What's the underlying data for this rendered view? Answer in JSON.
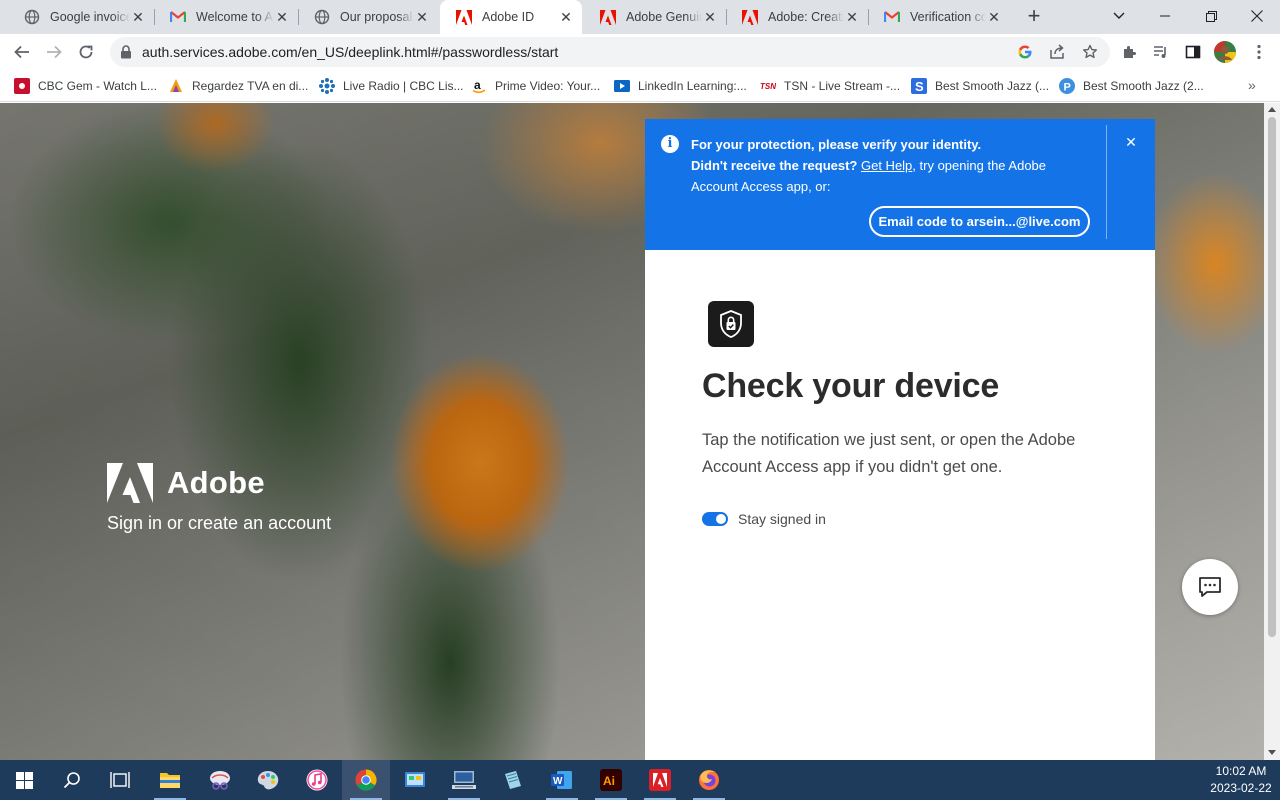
{
  "tabs": [
    {
      "title": "Google invoice",
      "favicon": "globe-icon"
    },
    {
      "title": "Welcome to Adobe",
      "favicon": "gmail-icon"
    },
    {
      "title": "Our proposal is",
      "favicon": "globe-icon"
    },
    {
      "title": "Adobe ID",
      "favicon": "adobe-icon",
      "active": true
    },
    {
      "title": "Adobe Genuine",
      "favicon": "adobe-icon"
    },
    {
      "title": "Adobe: Creative",
      "favicon": "adobe-icon"
    },
    {
      "title": "Verification code",
      "favicon": "gmail-icon"
    }
  ],
  "toolbar": {
    "url": "auth.services.adobe.com/en_US/deeplink.html#/passwordless/start"
  },
  "bookmarks": [
    {
      "label": "CBC Gem - Watch L...",
      "icon": "cbc-icon"
    },
    {
      "label": "Regardez TVA en di...",
      "icon": "tva-icon"
    },
    {
      "label": "Live Radio | CBC Lis...",
      "icon": "cbc-radio-icon"
    },
    {
      "label": "Prime Video: Your...",
      "icon": "amazon-icon"
    },
    {
      "label": "LinkedIn Learning:...",
      "icon": "linkedin-learning-icon"
    },
    {
      "label": "TSN - Live Stream -...",
      "icon": "tsn-icon"
    },
    {
      "label": "Best Smooth Jazz (...",
      "icon": "smooth-jazz-icon"
    },
    {
      "label": "Best Smooth Jazz (2...",
      "icon": "pandora-icon"
    }
  ],
  "brand": {
    "name": "Adobe",
    "tagline": "Sign in or create an account"
  },
  "toast": {
    "line1": "For your protection, please verify your identity.",
    "line2_prefix": "Didn't receive the request? ",
    "help_link": "Get Help",
    "line2_suffix": ", try opening the Adobe Account Access app, or:",
    "email_button": "Email code to arsein...@live.com"
  },
  "card": {
    "heading": "Check your device",
    "description": "Tap the notification we just sent, or open the Adobe Account Access app if you didn't get one.",
    "stay_signed_in": "Stay signed in",
    "stay_signed_in_on": true
  },
  "taskbar": {
    "time": "10:02 AM",
    "date": "2023-02-22"
  },
  "colors": {
    "adobe_blue": "#1473e6",
    "adobe_red": "#eb1000",
    "taskbar": "#1f3b5c"
  }
}
